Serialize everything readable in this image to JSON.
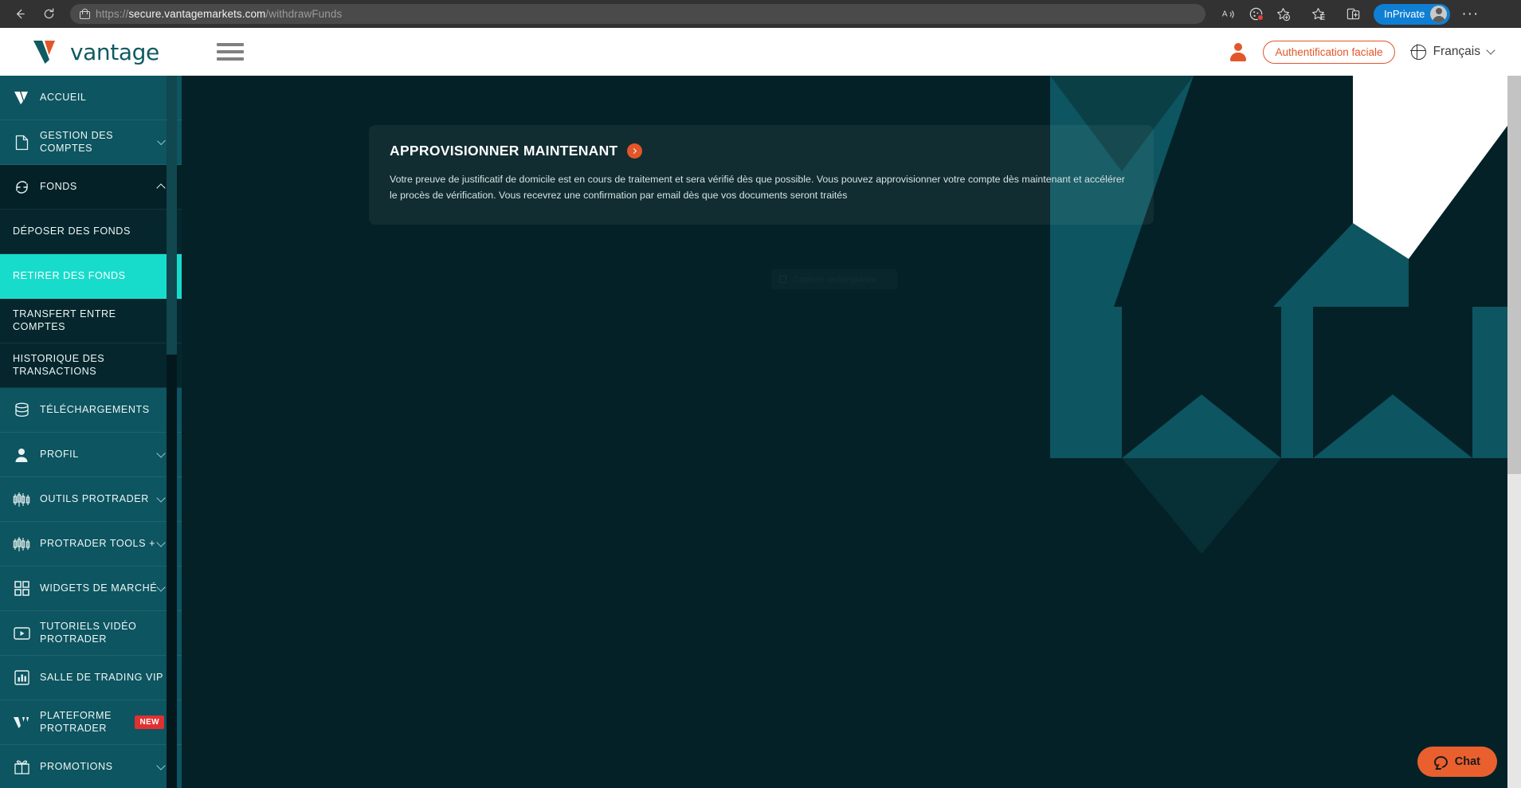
{
  "browser": {
    "back_label": "Back",
    "reload_label": "Reload",
    "url_scheme": "https://",
    "url_domain": "secure.vantagemarkets.com",
    "url_path": "/withdrawFunds",
    "read_aloud_label": "Read aloud",
    "cookies_label": "Tracking prevention",
    "collections_label": "Collections",
    "favorites_label": "Favorites",
    "split_screen_label": "Split screen",
    "inprivate_label": "InPrivate",
    "settings_label": "Settings and more"
  },
  "header": {
    "brand": "vantage",
    "menu_label": "Menu",
    "face_auth_label": "Authentification faciale",
    "language": "Français"
  },
  "sidebar": {
    "items": [
      {
        "label": "ACCUEIL",
        "icon": "vantage-v-icon",
        "level": "lvl1",
        "chevron": ""
      },
      {
        "label": "GESTION DES COMPTES",
        "icon": "document-icon",
        "level": "lvl1",
        "chevron": "down"
      },
      {
        "label": "FONDS",
        "icon": "funds-refresh-icon",
        "level": "lvl1-dark",
        "chevron": "up"
      },
      {
        "label": "DÉPOSER DES FONDS",
        "icon": "",
        "level": "sub",
        "chevron": ""
      },
      {
        "label": "RETIRER DES FONDS",
        "icon": "",
        "level": "sub-active",
        "chevron": ""
      },
      {
        "label": "TRANSFERT ENTRE COMPTES",
        "icon": "",
        "level": "sub",
        "chevron": ""
      },
      {
        "label": "HISTORIQUE DES TRANSACTIONS",
        "icon": "",
        "level": "sub",
        "chevron": ""
      },
      {
        "label": "TÉLÉCHARGEMENTS",
        "icon": "database-icon",
        "level": "lvl1",
        "chevron": ""
      },
      {
        "label": "PROFIL",
        "icon": "person-icon",
        "level": "lvl1",
        "chevron": "down"
      },
      {
        "label": "OUTILS PROTRADER",
        "icon": "candlestick-icon",
        "level": "lvl1",
        "chevron": "down"
      },
      {
        "label": "PROTRADER TOOLS +",
        "icon": "candlestick-icon",
        "level": "lvl1",
        "chevron": "down"
      },
      {
        "label": "WIDGETS DE MARCHÉ",
        "icon": "grid-icon",
        "level": "lvl1",
        "chevron": "down"
      },
      {
        "label": "TUTORIELS VIDÉO PROTRADER",
        "icon": "video-icon",
        "level": "lvl1",
        "chevron": ""
      },
      {
        "label": "SALLE DE TRADING VIP",
        "icon": "bar-chart-icon",
        "level": "lvl1",
        "chevron": ""
      },
      {
        "label": "PLATEFORME PROTRADER",
        "icon": "protrader-icon",
        "level": "lvl1",
        "chevron": "",
        "badge": "NEW"
      },
      {
        "label": "PROMOTIONS",
        "icon": "gift-icon",
        "level": "lvl1",
        "chevron": "down"
      }
    ]
  },
  "banner": {
    "title": "APPROVISIONNER MAINTENANT",
    "body": "Votre preuve de justificatif de domicile est en cours de traitement et sera vérifié dès que possible. Vous pouvez approvisionner votre compte dès maintenant et accélérer le procès de vérification. Vous recevrez une confirmation par email dès que vos documents seront traités"
  },
  "overlay": {
    "snip_tool_label": "Capture rectangulaire"
  },
  "chat": {
    "label": "Chat"
  },
  "colors": {
    "accent_orange": "#e2562a",
    "brand_teal": "#0e5b61",
    "active_cyan": "#18dccb",
    "sidebar_dark": "#042127",
    "badge_red": "#e03131"
  }
}
